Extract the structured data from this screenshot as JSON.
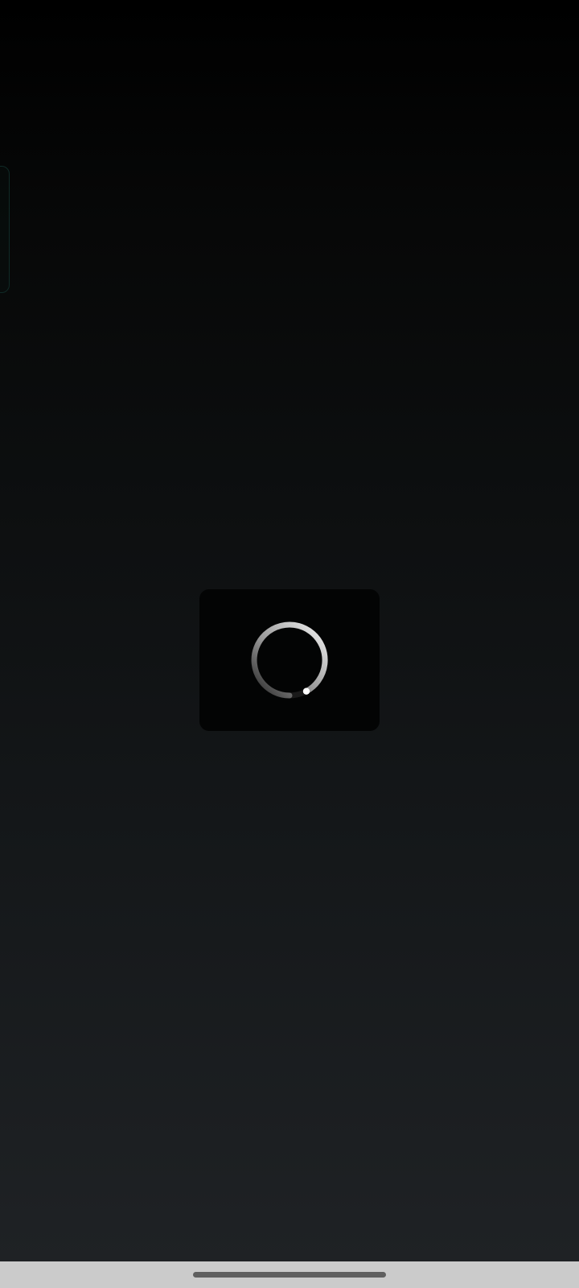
{
  "screen": {
    "state": "loading",
    "background_top_color": "#000000",
    "background_bottom_color": "#1f2225"
  },
  "loading_dialog": {
    "background_color": "#030404",
    "spinner_icon": "circular-progress-icon",
    "spinner_color": "#ffffff"
  },
  "navigation_bar": {
    "background_color": "#cbcbcb",
    "home_indicator_color": "#5f5f5f"
  }
}
